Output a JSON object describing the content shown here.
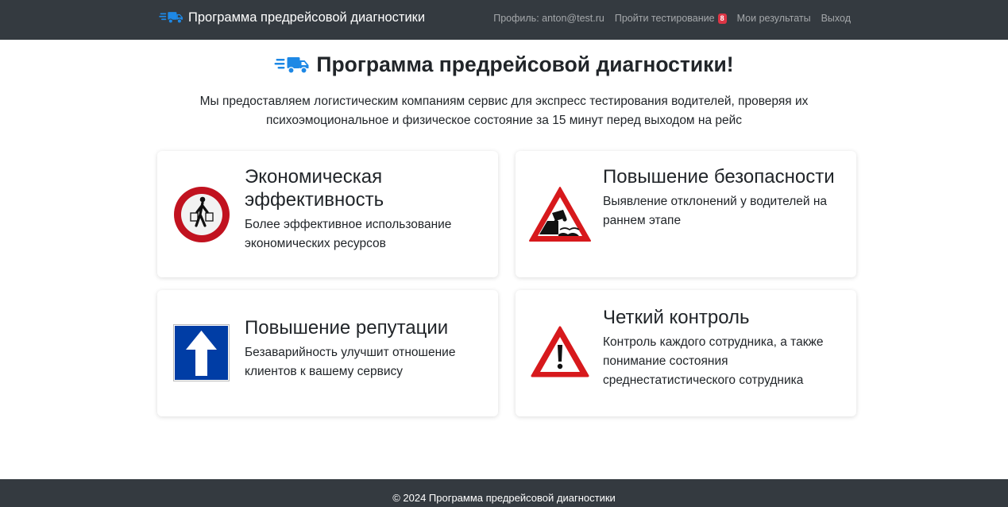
{
  "navbar": {
    "brand": "Программа предрейсовой диагностики",
    "links": {
      "profile": "Профиль: anton@test.ru",
      "take_test": "Пройти тестирование",
      "take_test_badge": "8",
      "results": "Мои результаты",
      "logout": "Выход"
    }
  },
  "hero": {
    "title": "Программа предрейсовой диагностики!",
    "lead": "Мы предоставляем логистическим компаниям сервис для экспресс тестирования водителей, проверяя их психоэмоциональное и физическое состояние за 15 минут перед выходом на рейс"
  },
  "features": [
    {
      "title": "Экономическая эффективность",
      "text": "Более эффективное использование экономических ресурсов",
      "icon": "no-pedestrians-sign-icon"
    },
    {
      "title": "Повышение безопасности",
      "text": "Выявление отклонений у водителей на раннем этапе",
      "icon": "quayside-warning-sign-icon"
    },
    {
      "title": "Повышение репутации",
      "text": "Безаварийность улучшит отношение клиентов к вашему сервису",
      "icon": "one-way-sign-icon"
    },
    {
      "title": "Четкий контроль",
      "text": "Контроль каждого сотрудника, а также понимание состояния среднестатистического сотрудника",
      "icon": "exclamation-warning-sign-icon"
    }
  ],
  "footer": {
    "text": "© 2024 Программа предрейсовой диагностики"
  },
  "colors": {
    "navbar": "#343a40",
    "accent_blue": "#1e88e5",
    "badge": "#dc3545",
    "sign_red": "#c1121f",
    "sign_blue": "#003da5"
  }
}
